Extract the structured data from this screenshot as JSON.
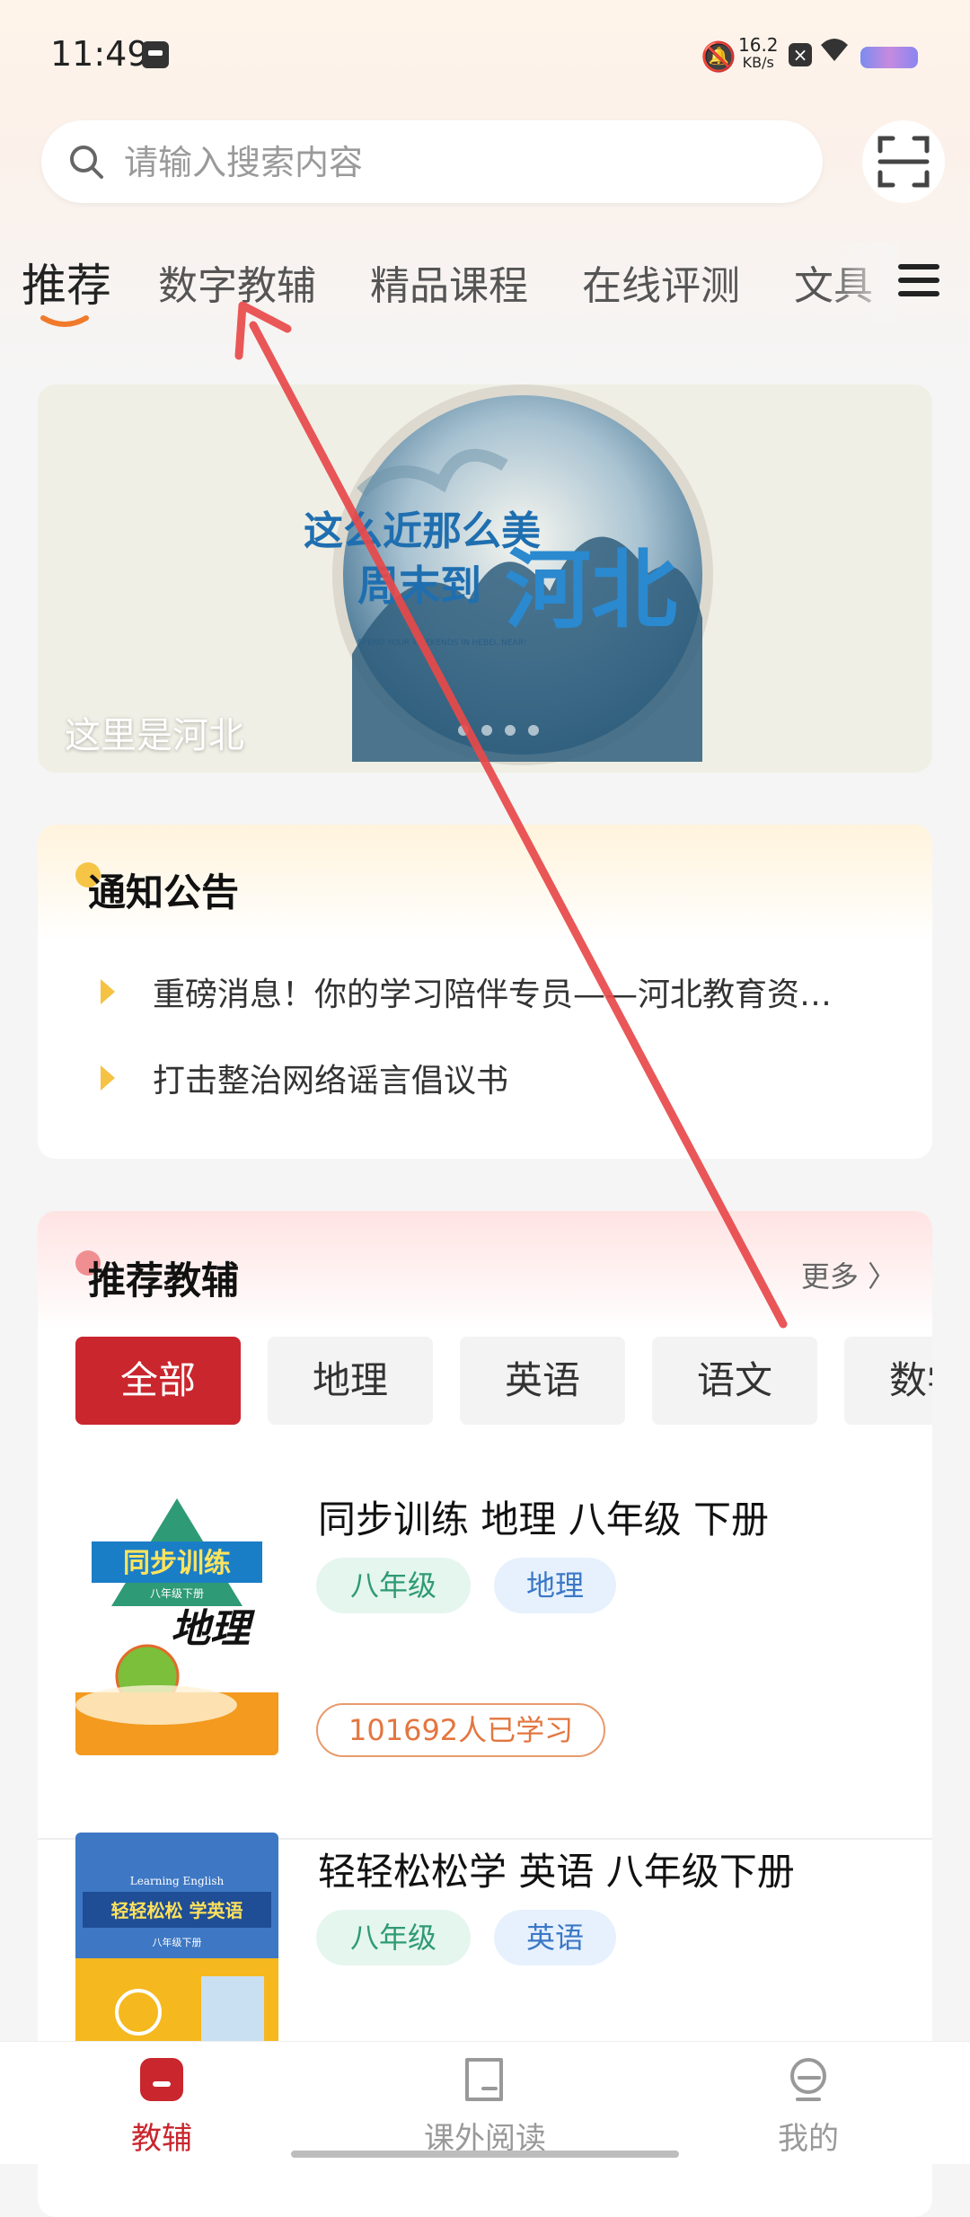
{
  "status_bar": {
    "time": "11:49",
    "net_speed_value": "16.2",
    "net_speed_unit": "KB/s"
  },
  "search": {
    "placeholder": "请输入搜索内容"
  },
  "tabs": [
    {
      "label": "推荐",
      "active": true
    },
    {
      "label": "数字教辅"
    },
    {
      "label": "精品课程"
    },
    {
      "label": "在线评测"
    },
    {
      "label": "文具"
    }
  ],
  "banner": {
    "caption": "这里是河北",
    "image_line1": "这么近那么美",
    "image_line2": "周末到",
    "image_big": "河北",
    "image_small": "SPEND YOUR WEEKENDS IN HEBEI, NEAR!"
  },
  "notice": {
    "title": "通知公告",
    "items": [
      "重磅消息！你的学习陪伴专员——河北教育资…",
      "打击整治网络谣言倡议书"
    ]
  },
  "recommend": {
    "title": "推荐教辅",
    "more": "更多 〉",
    "chips": [
      "全部",
      "地理",
      "英语",
      "语文",
      "数学"
    ],
    "books": [
      {
        "title": "同步训练 地理 八年级 下册",
        "grade": "八年级",
        "subject": "地理",
        "learners": "101692人已学习",
        "cover_text_1": "同步训练",
        "cover_text_2": "八年级下册",
        "cover_text_3": "地理"
      },
      {
        "title": "轻轻松松学 英语 八年级下册",
        "grade": "八年级",
        "subject": "英语",
        "cover_text_1": "轻轻松松 学英语",
        "cover_text_2": "Learning English",
        "cover_text_3": "八年级下册"
      }
    ]
  },
  "bottom_nav": [
    {
      "label": "教辅",
      "active": true
    },
    {
      "label": "课外阅读"
    },
    {
      "label": "我的"
    }
  ],
  "colors": {
    "accent": "#c9262e",
    "tab_underline": "#f07a2b",
    "arrow": "#e8494a"
  }
}
